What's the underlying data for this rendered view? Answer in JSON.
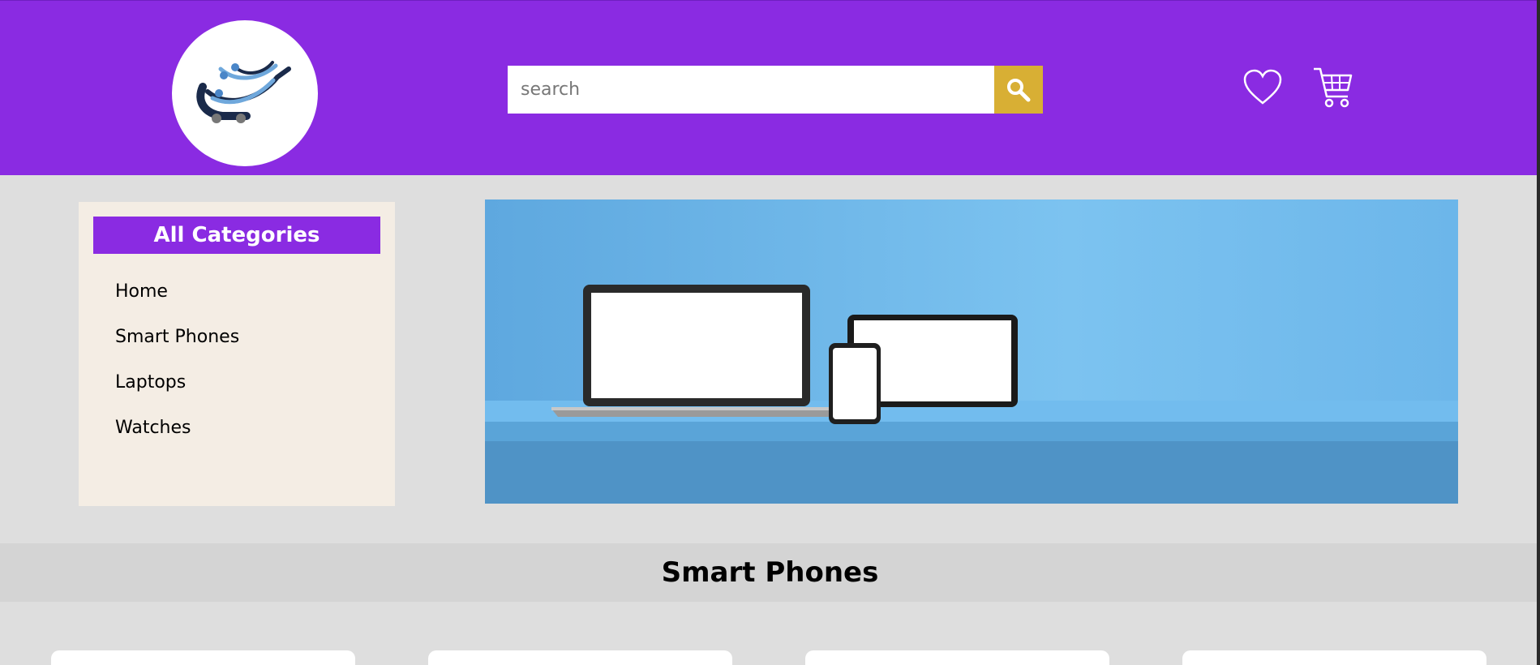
{
  "header": {
    "search_placeholder": "search",
    "icons": {
      "search": "search-icon",
      "wishlist": "heart-icon",
      "cart": "cart-icon",
      "logo": "shopping-cart-logo"
    }
  },
  "sidebar": {
    "title": "All Categories",
    "items": [
      {
        "label": "Home"
      },
      {
        "label": "Smart Phones"
      },
      {
        "label": "Laptops"
      },
      {
        "label": "Watches"
      }
    ]
  },
  "section": {
    "title": "Smart Phones"
  },
  "colors": {
    "brand": "#8a2be2",
    "search_button": "#d8af34",
    "sidebar_bg": "#f4ede4",
    "page_bg": "#dedede"
  }
}
